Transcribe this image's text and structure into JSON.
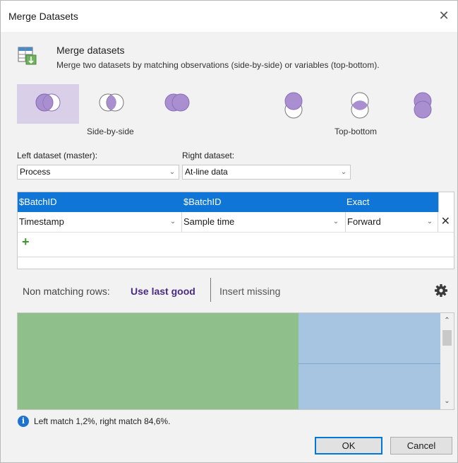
{
  "window": {
    "title": "Merge Datasets",
    "close_glyph": "✕"
  },
  "header": {
    "icon": "merge-datasets-icon",
    "title": "Merge datasets",
    "subtitle": "Merge two datasets by matching observations (side-by-side) or variables (top-bottom)."
  },
  "modes": {
    "side_by_side_label": "Side-by-side",
    "top_bottom_label": "Top-bottom",
    "selected": "side-by-side-left",
    "accent_color": "#a98fd0"
  },
  "left_dataset": {
    "label": "Left dataset (master):",
    "value": "Process"
  },
  "right_dataset": {
    "label": "Right dataset:",
    "value": "At-line data"
  },
  "match_table": {
    "header_row": {
      "left": "$BatchID",
      "right": "$BatchID",
      "method": "Exact"
    },
    "rows": [
      {
        "left": "Timestamp",
        "right": "Sample time",
        "method": "Forward",
        "delete_glyph": "✕"
      }
    ],
    "add_glyph": "+"
  },
  "non_matching": {
    "label": "Non matching rows:",
    "option_selected": "Use last good",
    "option_other": "Insert missing"
  },
  "status": {
    "info_glyph": "i",
    "text": "Left match 1,2%, right match 84,6%."
  },
  "buttons": {
    "ok": "OK",
    "cancel": "Cancel"
  },
  "colors": {
    "selection_blue": "#0f76d8",
    "left_match_green": "#8fbf8b",
    "right_match_blue": "#a7c4e1",
    "selected_mode_bg": "#d9cfe8"
  }
}
